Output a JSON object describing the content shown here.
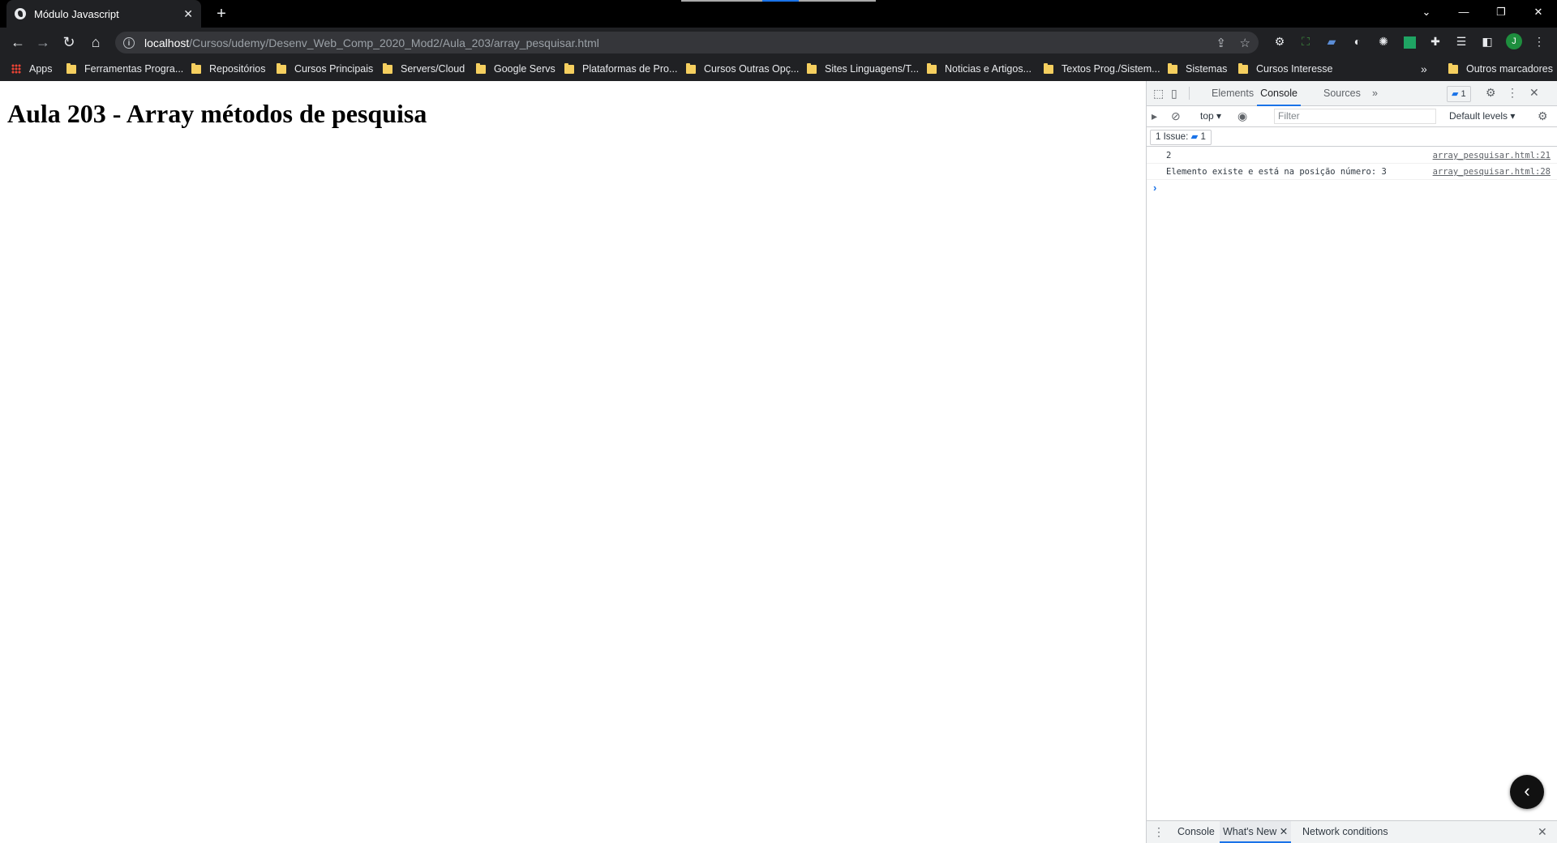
{
  "browser": {
    "tab_title": "Módulo Javascript",
    "tab_close": "✕",
    "new_tab": "+",
    "window_controls": [
      "⌄",
      "—",
      "❐",
      "✕"
    ],
    "url_host": "localhost",
    "url_path": "/Cursos/udemy/Desenv_Web_Comp_2020_Mod2/Aula_203/array_pesquisar.html",
    "profile_initial": "J",
    "bookmarks": [
      {
        "label": "Apps",
        "icon": "apps-grid-icon"
      },
      {
        "label": "Ferramentas Progra...",
        "icon": "folder-icon"
      },
      {
        "label": "Repositórios",
        "icon": "folder-icon"
      },
      {
        "label": "Cursos Principais",
        "icon": "folder-icon"
      },
      {
        "label": "Servers/Cloud",
        "icon": "folder-icon"
      },
      {
        "label": "Google Servs",
        "icon": "folder-icon"
      },
      {
        "label": "Plataformas de Pro...",
        "icon": "folder-icon"
      },
      {
        "label": "Cursos Outras Opç...",
        "icon": "folder-icon"
      },
      {
        "label": "Sites Linguagens/T...",
        "icon": "folder-icon"
      },
      {
        "label": "Noticias e Artigos...",
        "icon": "folder-icon"
      },
      {
        "label": "Textos Prog./Sistem...",
        "icon": "folder-icon"
      },
      {
        "label": "Sistemas",
        "icon": "folder-icon"
      },
      {
        "label": "Cursos Interesse",
        "icon": "folder-icon"
      }
    ],
    "bookmarks_overflow": "»",
    "other_bookmarks": "Outros marcadores"
  },
  "page": {
    "heading": "Aula 203 - Array métodos de pesquisa"
  },
  "devtools": {
    "tabs": [
      "Elements",
      "Console",
      "Sources"
    ],
    "active_tab": "Console",
    "more_tabs": "»",
    "issue_badge_count": "1",
    "context": "top",
    "filter_placeholder": "Filter",
    "levels": "Default levels",
    "issues_label": "1 Issue:",
    "issues_count": "1",
    "messages": [
      {
        "text": "2",
        "source": "array_pesquisar.html:21"
      },
      {
        "text": "Elemento existe e está na posição número: 3",
        "source": "array_pesquisar.html:28"
      }
    ],
    "prompt": "›",
    "drawer_tabs": [
      "Console",
      "What's New",
      "Network conditions"
    ],
    "drawer_active": "What's New"
  },
  "colors": {
    "titlebar": "#000000",
    "toolbar": "#202124",
    "accent": "#1a73e8",
    "folder": "#f5cf5f"
  }
}
